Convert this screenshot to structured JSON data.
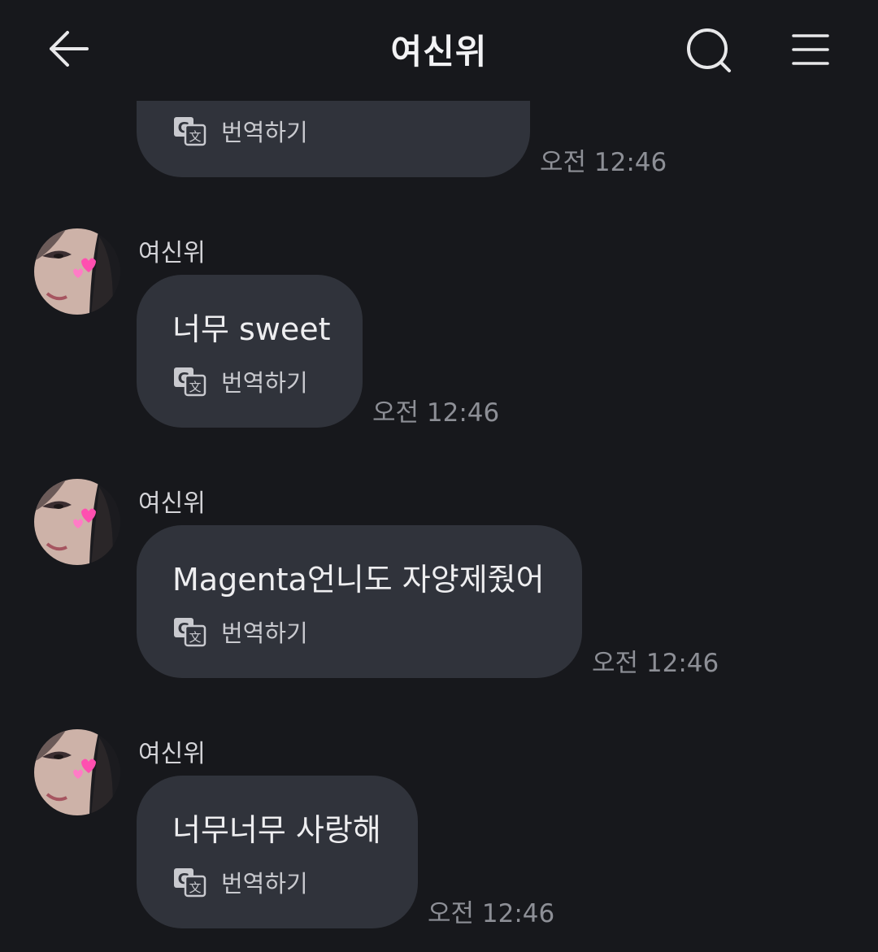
{
  "header": {
    "title": "여신위"
  },
  "messages": [
    {
      "sender": "",
      "text": "",
      "translate_label": "번역하기",
      "time": "오전 12:46"
    },
    {
      "sender": "여신위",
      "text": "너무 sweet",
      "translate_label": "번역하기",
      "time": "오전 12:46"
    },
    {
      "sender": "여신위",
      "text": "Magenta언니도 자양제줬어",
      "translate_label": "번역하기",
      "time": "오전 12:46"
    },
    {
      "sender": "여신위",
      "text": "너무너무 사랑해",
      "translate_label": "번역하기",
      "time": "오전 12:46"
    }
  ],
  "icons": {
    "back": "arrow-left-icon",
    "search": "search-icon",
    "menu": "hamburger-menu-icon",
    "translate": "translate-icon"
  },
  "colors": {
    "background": "#17181c",
    "bubble": "#30333b",
    "time": "#8d8f96"
  }
}
